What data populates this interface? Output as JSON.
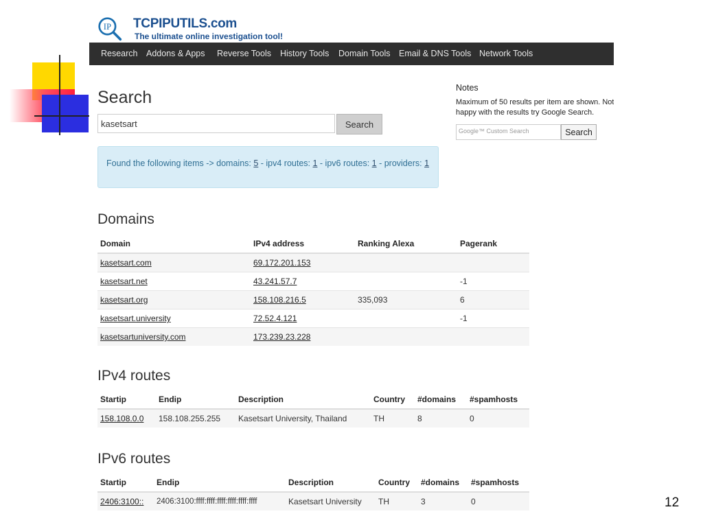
{
  "slide": {
    "number": "12"
  },
  "logo": {
    "title": "TCPIPUTILS.com",
    "tagline": "The ultimate online investigation tool!",
    "mark": "IP"
  },
  "nav": [
    "Research",
    "Addons & Apps",
    "Reverse Tools",
    "History Tools",
    "Domain Tools",
    "Email & DNS Tools",
    "Network Tools"
  ],
  "search": {
    "heading": "Search",
    "value": "kasetsart",
    "button": "Search"
  },
  "alert": {
    "prefix": "Found the following items -> domains: ",
    "domains": "5",
    "sep1": " - ipv4 routes: ",
    "ipv4": "1",
    "sep2": " - ipv6 routes: ",
    "ipv6": "1",
    "sep3": " - providers: ",
    "providers": "1"
  },
  "notes": {
    "title": "Notes",
    "text": "Maximum of 50 results per item are shown. Not happy with the results try Google Search.",
    "gcse_placeholder": "Google™ Custom Search",
    "gcse_button": "Search"
  },
  "domains": {
    "title": "Domains",
    "headers": [
      "Domain",
      "IPv4 address",
      "Ranking Alexa",
      "Pagerank"
    ],
    "rows": [
      [
        "kasetsart.com",
        "69.172.201.153",
        "",
        ""
      ],
      [
        "kasetsart.net",
        "43.241.57.7",
        "",
        "-1"
      ],
      [
        "kasetsart.org",
        "158.108.216.5",
        "335,093",
        "6"
      ],
      [
        "kasetsart.university",
        "72.52.4.121",
        "",
        "-1"
      ],
      [
        "kasetsartuniversity.com",
        "173.239.23.228",
        "",
        ""
      ]
    ]
  },
  "ipv4": {
    "title": "IPv4 routes",
    "headers": [
      "Startip",
      "Endip",
      "Description",
      "Country",
      "#domains",
      "#spamhosts"
    ],
    "rows": [
      [
        "158.108.0.0",
        "158.108.255.255",
        "Kasetsart University, Thailand",
        "TH",
        "8",
        "0"
      ]
    ]
  },
  "ipv6": {
    "title": "IPv6 routes",
    "headers": [
      "Startip",
      "Endip",
      "Description",
      "Country",
      "#domains",
      "#spamhosts"
    ],
    "rows": [
      [
        "2406:3100::",
        "2406:3100:ffff:ffff:ffff:ffff:ffff:ffff",
        "Kasetsart University",
        "TH",
        "3",
        "0"
      ]
    ]
  }
}
